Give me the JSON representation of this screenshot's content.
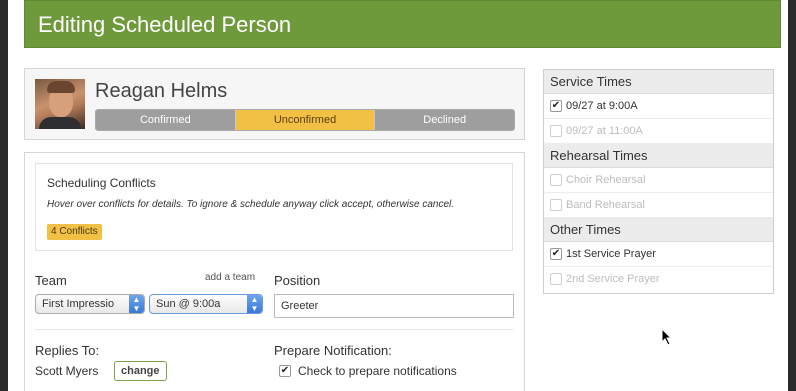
{
  "header": {
    "title": "Editing Scheduled Person"
  },
  "person": {
    "name": "Reagan Helms",
    "status_options": [
      {
        "label": "Confirmed",
        "active": false
      },
      {
        "label": "Unconfirmed",
        "active": true
      },
      {
        "label": "Declined",
        "active": false
      }
    ]
  },
  "conflicts": {
    "title": "Scheduling Conflicts",
    "hint": "Hover over conflicts for details. To ignore & schedule anyway click accept, otherwise cancel.",
    "badge": "4 Conflicts"
  },
  "team": {
    "label": "Team",
    "add_link": "add a team",
    "team_select": "First Impressio",
    "time_select": "Sun @ 9:00a"
  },
  "position": {
    "label": "Position",
    "value": "Greeter"
  },
  "replies": {
    "label": "Replies To:",
    "name": "Scott Myers",
    "change_label": "change"
  },
  "notification": {
    "label": "Prepare Notification:",
    "checkbox_label": "Check to prepare notifications",
    "checked": true
  },
  "side": {
    "service_times": {
      "title": "Service Times",
      "items": [
        {
          "label": "09/27 at 9:00A",
          "checked": true,
          "enabled": true
        },
        {
          "label": "09/27 at 11:00A",
          "checked": false,
          "enabled": false
        }
      ]
    },
    "rehearsal_times": {
      "title": "Rehearsal Times",
      "items": [
        {
          "label": "Choir Rehearsal",
          "checked": false,
          "enabled": false
        },
        {
          "label": "Band Rehearsal",
          "checked": false,
          "enabled": false
        }
      ]
    },
    "other_times": {
      "title": "Other Times",
      "items": [
        {
          "label": "1st Service Prayer",
          "checked": true,
          "enabled": true
        },
        {
          "label": "2nd Service Prayer",
          "checked": false,
          "enabled": false
        }
      ]
    }
  },
  "colors": {
    "header": "#6e9a3c",
    "active_status": "#f2c045",
    "badge": "#f2c045"
  }
}
